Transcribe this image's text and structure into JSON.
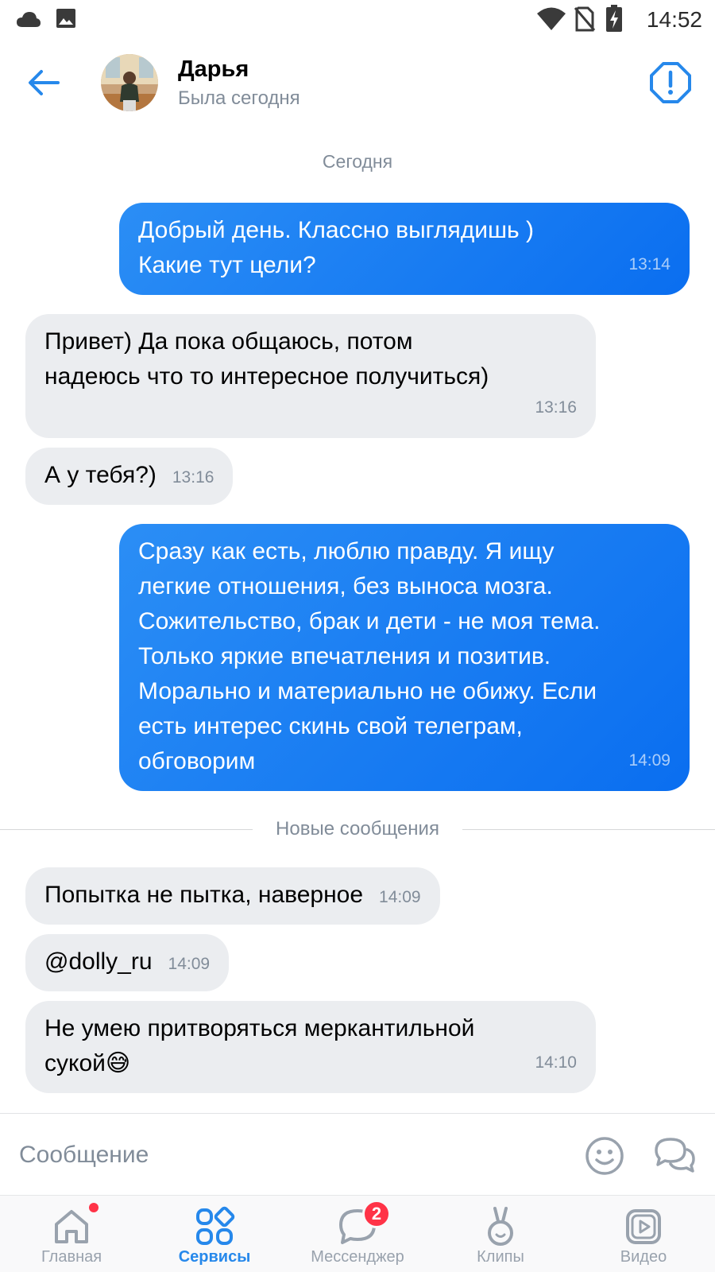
{
  "status_bar": {
    "time": "14:52",
    "icons": [
      "cloud-icon",
      "image-icon",
      "wifi-icon",
      "no-sim-icon",
      "battery-charging-icon"
    ]
  },
  "header": {
    "contact_name": "Дарья",
    "contact_status": "Была сегодня",
    "back_icon": "back-arrow-icon",
    "report_icon": "alert-octagon-icon"
  },
  "chat": {
    "date_separator": "Сегодня",
    "new_messages_label": "Новые сообщения",
    "messages": [
      {
        "direction": "out",
        "text": "Добрый день. Классно выглядишь )\nКакие тут цели?",
        "time": "13:14"
      },
      {
        "direction": "in",
        "text": "Привет) Да пока общаюсь, потом\nнадеюсь что то интересное получиться)",
        "time": "13:16"
      },
      {
        "direction": "in",
        "text": "А у тебя?)",
        "time": "13:16"
      },
      {
        "direction": "out",
        "text": "Сразу как есть, люблю правду. Я ищу\nлегкие отношения, без выноса мозга.\nСожительство, брак и дети - не моя тема.\nТолько яркие впечатления и позитив.\nМорально и материально не обижу. Если\nесть интерес скинь свой телеграм,\nобговорим",
        "time": "14:09"
      },
      {
        "direction": "in",
        "text": "Попытка не пытка, наверное",
        "time": "14:09"
      },
      {
        "direction": "in",
        "text": "@dolly_ru",
        "time": "14:09"
      },
      {
        "direction": "in",
        "text": "Не умею притворяться меркантильной\nсукой😅",
        "time": "14:10"
      }
    ]
  },
  "input": {
    "placeholder": "Сообщение",
    "emoji_icon": "smiley-icon",
    "send_icon": "chat-bubbles-icon"
  },
  "bottom_nav": {
    "items": [
      {
        "label": "Главная",
        "icon": "home-icon",
        "active": false,
        "dot": true
      },
      {
        "label": "Сервисы",
        "icon": "services-grid-icon",
        "active": true
      },
      {
        "label": "Мессенджер",
        "icon": "messenger-icon",
        "active": false,
        "badge": "2"
      },
      {
        "label": "Клипы",
        "icon": "clips-icon",
        "active": false
      },
      {
        "label": "Видео",
        "icon": "video-icon",
        "active": false
      }
    ]
  },
  "colors": {
    "accent": "#2688eb",
    "outgoing_bubble": "#0a6ef0",
    "incoming_bubble": "#ebedf0",
    "badge": "#ff3347"
  }
}
